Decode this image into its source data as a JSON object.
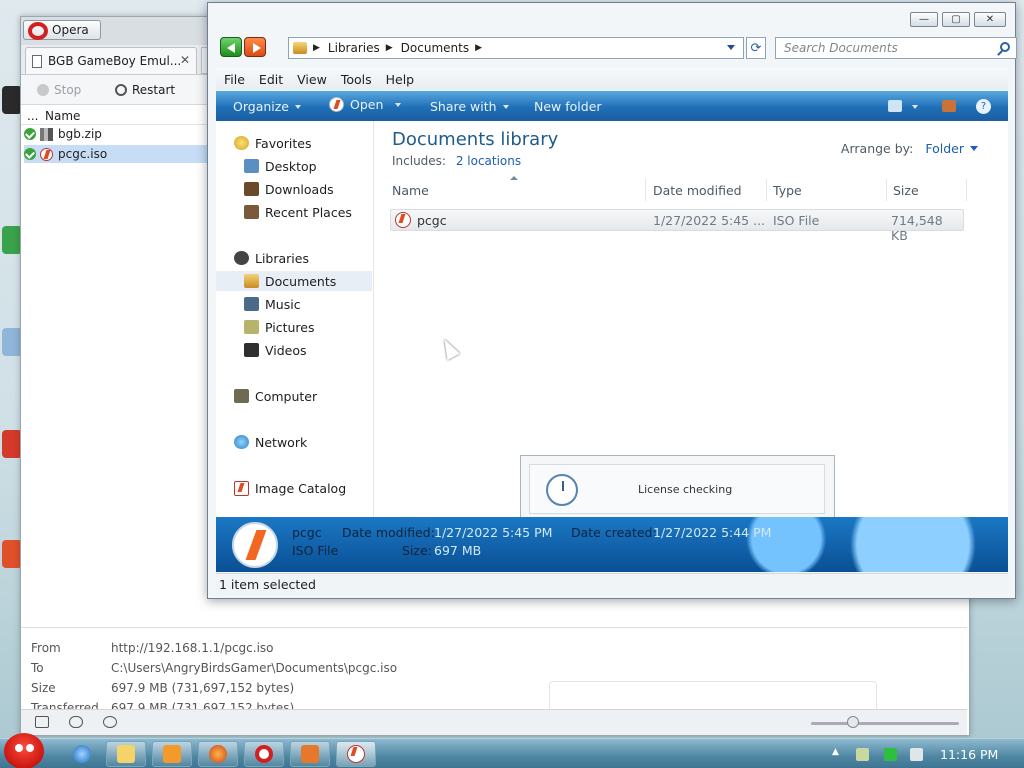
{
  "opera": {
    "app_button": "Opera",
    "tab_title": "BGB GameBoy Emul...",
    "tab_close": "✕",
    "toolbar": {
      "stop": "Stop",
      "restart": "Restart"
    },
    "list": {
      "header_dots": "...",
      "header_name": "Name",
      "items": [
        {
          "name": "bgb.zip"
        },
        {
          "name": "pcgc.iso"
        }
      ]
    },
    "details": {
      "from_label": "From",
      "from_value": "http://192.168.1.1/pcgc.iso",
      "to_label": "To",
      "to_value": "C:\\Users\\AngryBirdsGamer\\Documents\\pcgc.iso",
      "size_label": "Size",
      "size_value": "697.9 MB (731,697,152 bytes)",
      "transferred_label": "Transferred",
      "transferred_value": "697.9 MB (731,697,152 bytes)"
    }
  },
  "explorer": {
    "caption": {
      "minimize": "—",
      "maximize": "▢",
      "close": "✕"
    },
    "address": {
      "crumbs": [
        "Libraries",
        "Documents"
      ]
    },
    "search_placeholder": "Search Documents",
    "menu": [
      "File",
      "Edit",
      "View",
      "Tools",
      "Help"
    ],
    "commands": {
      "organize": "Organize",
      "open": "Open",
      "share": "Share with",
      "new_folder": "New folder"
    },
    "nav": {
      "favorites": "Favorites",
      "desktop": "Desktop",
      "downloads": "Downloads",
      "recent": "Recent Places",
      "libraries": "Libraries",
      "documents": "Documents",
      "music": "Music",
      "pictures": "Pictures",
      "videos": "Videos",
      "computer": "Computer",
      "network": "Network",
      "image_catalog": "Image Catalog"
    },
    "library": {
      "title": "Documents library",
      "includes_label": "Includes:",
      "includes_link": "2 locations",
      "arrange_label": "Arrange by:",
      "arrange_value": "Folder"
    },
    "columns": {
      "name": "Name",
      "date": "Date modified",
      "type": "Type",
      "size": "Size"
    },
    "files": [
      {
        "name": "pcgc",
        "date": "1/27/2022 5:45 ...",
        "type": "ISO File",
        "size": "714,548 KB"
      }
    ],
    "dialog_text": "License checking",
    "preview": {
      "name": "pcgc",
      "type": "ISO File",
      "modified_label": "Date modified:",
      "modified_value": "1/27/2022 5:45 PM",
      "created_label": "Date created:",
      "created_value": "1/27/2022 5:44 PM",
      "size_label": "Size:",
      "size_value": "697 MB"
    },
    "status": "1 item selected"
  },
  "taskbar": {
    "time": "11:16 PM"
  },
  "colors": {
    "accent_blue": "#1f6fb8",
    "title_blue": "#1e5c8c",
    "link_blue": "#1d5fb4",
    "opera_red": "#d41f1f"
  }
}
